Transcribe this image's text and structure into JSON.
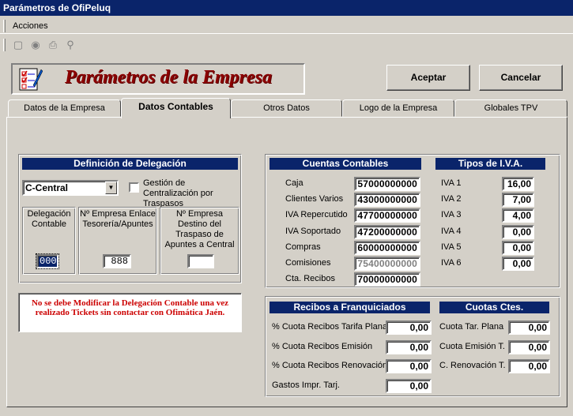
{
  "window": {
    "title": "Parámetros de OfiPeluq"
  },
  "menu": {
    "acciones": "Acciones"
  },
  "toolbar": {
    "icons": [
      "new-icon",
      "view-icon",
      "print-icon",
      "search-icon"
    ]
  },
  "banner": {
    "title": "Parámetros de la Empresa"
  },
  "buttons": {
    "accept": "Aceptar",
    "cancel": "Cancelar"
  },
  "tabs": [
    {
      "label": "Datos de la Empresa"
    },
    {
      "label": "Datos Contables"
    },
    {
      "label": "Otros Datos"
    },
    {
      "label": "Logo de la Empresa"
    },
    {
      "label": "Globales TPV"
    }
  ],
  "delegacion": {
    "title": "Definición de Delegación",
    "select_value": "C-Central",
    "checkbox_label": "Gestión de Centralización por Traspasos",
    "col1_label": "Delegación Contable",
    "col1_value": "000",
    "col2_label": "Nº Empresa Enlace Tesorería/Apuntes",
    "col2_value": "888",
    "col3_label": "Nº Empresa Destino del Traspaso de Apuntes a Central",
    "col3_value": ""
  },
  "warning": "No se debe Modificar la Delegación Contable una vez realizado Tickets sin contactar con Ofimática Jaén.",
  "cuentas": {
    "title": "Cuentas Contables",
    "rows": [
      {
        "label": "Caja",
        "value": "57000000000"
      },
      {
        "label": "Clientes Varios",
        "value": "43000000000"
      },
      {
        "label": "IVA Repercutido",
        "value": "47700000000"
      },
      {
        "label": "IVA Soportado",
        "value": "47200000000"
      },
      {
        "label": "Compras",
        "value": "60000000000"
      },
      {
        "label": "Comisiones",
        "value": "75400000000"
      },
      {
        "label": "Cta. Recibos",
        "value": "70000000000"
      }
    ]
  },
  "iva": {
    "title": "Tipos de I.V.A.",
    "rows": [
      {
        "label": "IVA 1",
        "value": "16,00"
      },
      {
        "label": "IVA 2",
        "value": "7,00"
      },
      {
        "label": "IVA 3",
        "value": "4,00"
      },
      {
        "label": "IVA 4",
        "value": "0,00"
      },
      {
        "label": "IVA 5",
        "value": "0,00"
      },
      {
        "label": "IVA 6",
        "value": "0,00"
      }
    ]
  },
  "recibos": {
    "title": "Recibos a Franquiciados",
    "rows": [
      {
        "label": "% Cuota Recibos Tarifa Plana",
        "value": "0,00"
      },
      {
        "label": "% Cuota Recibos Emisión",
        "value": "0,00"
      },
      {
        "label": "% Cuota Recibos Renovación",
        "value": "0,00"
      },
      {
        "label": "Gastos Impr. Tarj.",
        "value": "0,00"
      }
    ]
  },
  "cuotas": {
    "title": "Cuotas Ctes.",
    "rows": [
      {
        "label": "Cuota Tar. Plana",
        "value": "0,00"
      },
      {
        "label": "Cuota Emisión T.",
        "value": "0,00"
      },
      {
        "label": "C. Renovación T.",
        "value": "0,00"
      }
    ]
  }
}
